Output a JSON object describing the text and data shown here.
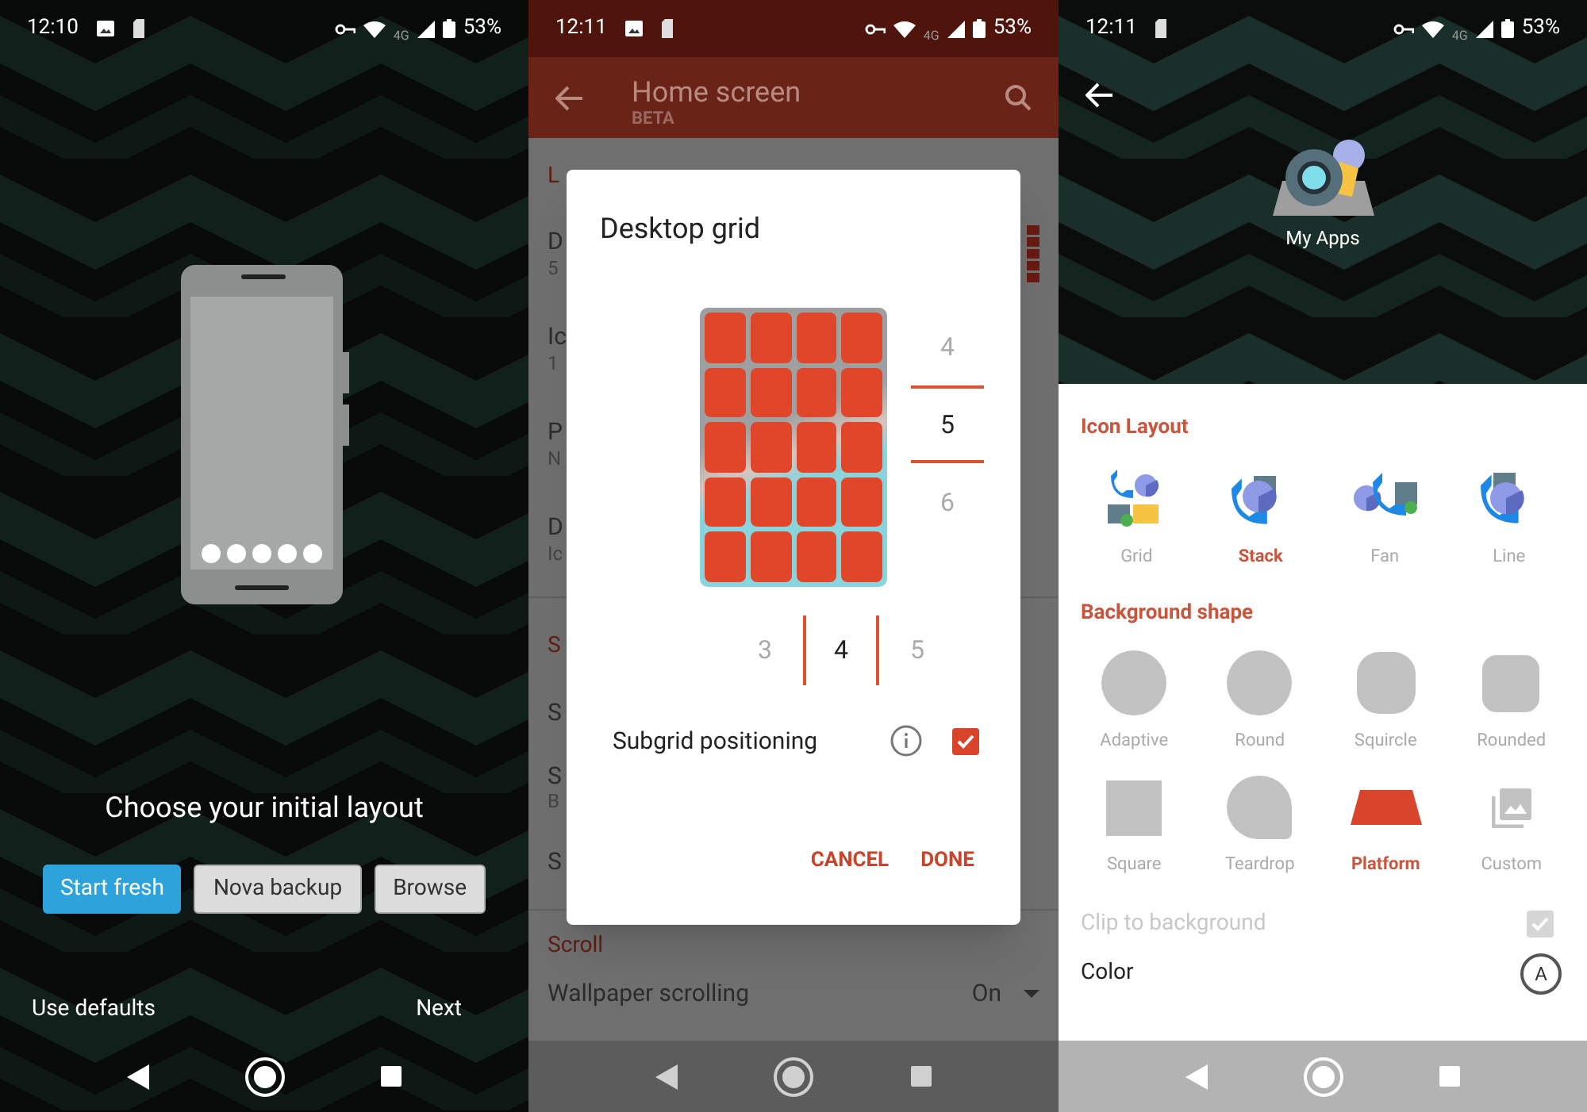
{
  "setup_screen": {
    "status_bar": {
      "time": "12:10",
      "notifications": [
        {
          "kind": "image"
        },
        {
          "kind": "card"
        }
      ],
      "network": "4G",
      "battery": "53%"
    },
    "title": "Choose your initial layout",
    "options": [
      {
        "label": "Start fresh",
        "selected": true
      },
      {
        "label": "Nova backup",
        "selected": false
      },
      {
        "label": "Browse",
        "selected": false
      }
    ],
    "footer": {
      "left": "Use defaults",
      "right": "Next"
    }
  },
  "settings_screen": {
    "status_bar": {
      "time": "12:11",
      "notifications": [
        {
          "kind": "image"
        },
        {
          "kind": "card"
        }
      ],
      "network": "4G",
      "battery": "53%"
    },
    "app_bar": {
      "title": "Home screen",
      "subtitle": "BETA"
    },
    "background_list": [
      {
        "header": "L",
        "items": [
          {
            "title": "D",
            "subtitle": "5"
          },
          {
            "title": "Ic",
            "subtitle": "1"
          },
          {
            "title": "P",
            "subtitle": "N"
          },
          {
            "title": "D",
            "subtitle": "Ic"
          }
        ]
      },
      {
        "header": "S",
        "items": [
          {
            "title": "S"
          },
          {
            "title": "S",
            "subtitle": "B"
          },
          {
            "title": "S"
          }
        ]
      },
      {
        "header": "Scroll",
        "items": [
          {
            "title": "Wallpaper scrolling",
            "value": "On"
          }
        ]
      }
    ],
    "dialog": {
      "title": "Desktop grid",
      "rows_picker": [
        {
          "label": "4",
          "selected": false
        },
        {
          "label": "5",
          "selected": true
        },
        {
          "label": "6",
          "selected": false
        }
      ],
      "columns_picker": [
        {
          "label": "3",
          "selected": false
        },
        {
          "label": "4",
          "selected": true
        },
        {
          "label": "5",
          "selected": false
        }
      ],
      "subgrid": {
        "label": "Subgrid positioning",
        "checked": true
      },
      "buttons": [
        "CANCEL",
        "DONE"
      ]
    }
  },
  "icon_screen": {
    "status_bar": {
      "time": "12:11",
      "notifications": [
        {
          "kind": "card"
        }
      ],
      "network": "4G",
      "battery": "53%"
    },
    "folder": {
      "label": "My Apps"
    },
    "icon_layout": {
      "title": "Icon Layout",
      "options": [
        {
          "label": "Grid",
          "kind": "grid",
          "selected": false
        },
        {
          "label": "Stack",
          "kind": "stack",
          "selected": true
        },
        {
          "label": "Fan",
          "kind": "fan",
          "selected": false
        },
        {
          "label": "Line",
          "kind": "line",
          "selected": false
        }
      ]
    },
    "background_shape": {
      "title": "Background shape",
      "options": [
        {
          "label": "Adaptive",
          "kind": "circle",
          "selected": false
        },
        {
          "label": "Round",
          "kind": "circle",
          "selected": false
        },
        {
          "label": "Squircle",
          "kind": "squircle",
          "selected": false
        },
        {
          "label": "Rounded",
          "kind": "rounded",
          "selected": false
        },
        {
          "label": "Square",
          "kind": "square",
          "selected": false
        },
        {
          "label": "Teardrop",
          "kind": "teardrop",
          "selected": false
        },
        {
          "label": "Platform",
          "kind": "platform",
          "selected": true
        },
        {
          "label": "Custom",
          "kind": "custom",
          "selected": false
        }
      ]
    },
    "clip": {
      "label": "Clip to background",
      "checked": true,
      "disabled": true
    },
    "color": {
      "label": "Color",
      "value": "A"
    }
  }
}
